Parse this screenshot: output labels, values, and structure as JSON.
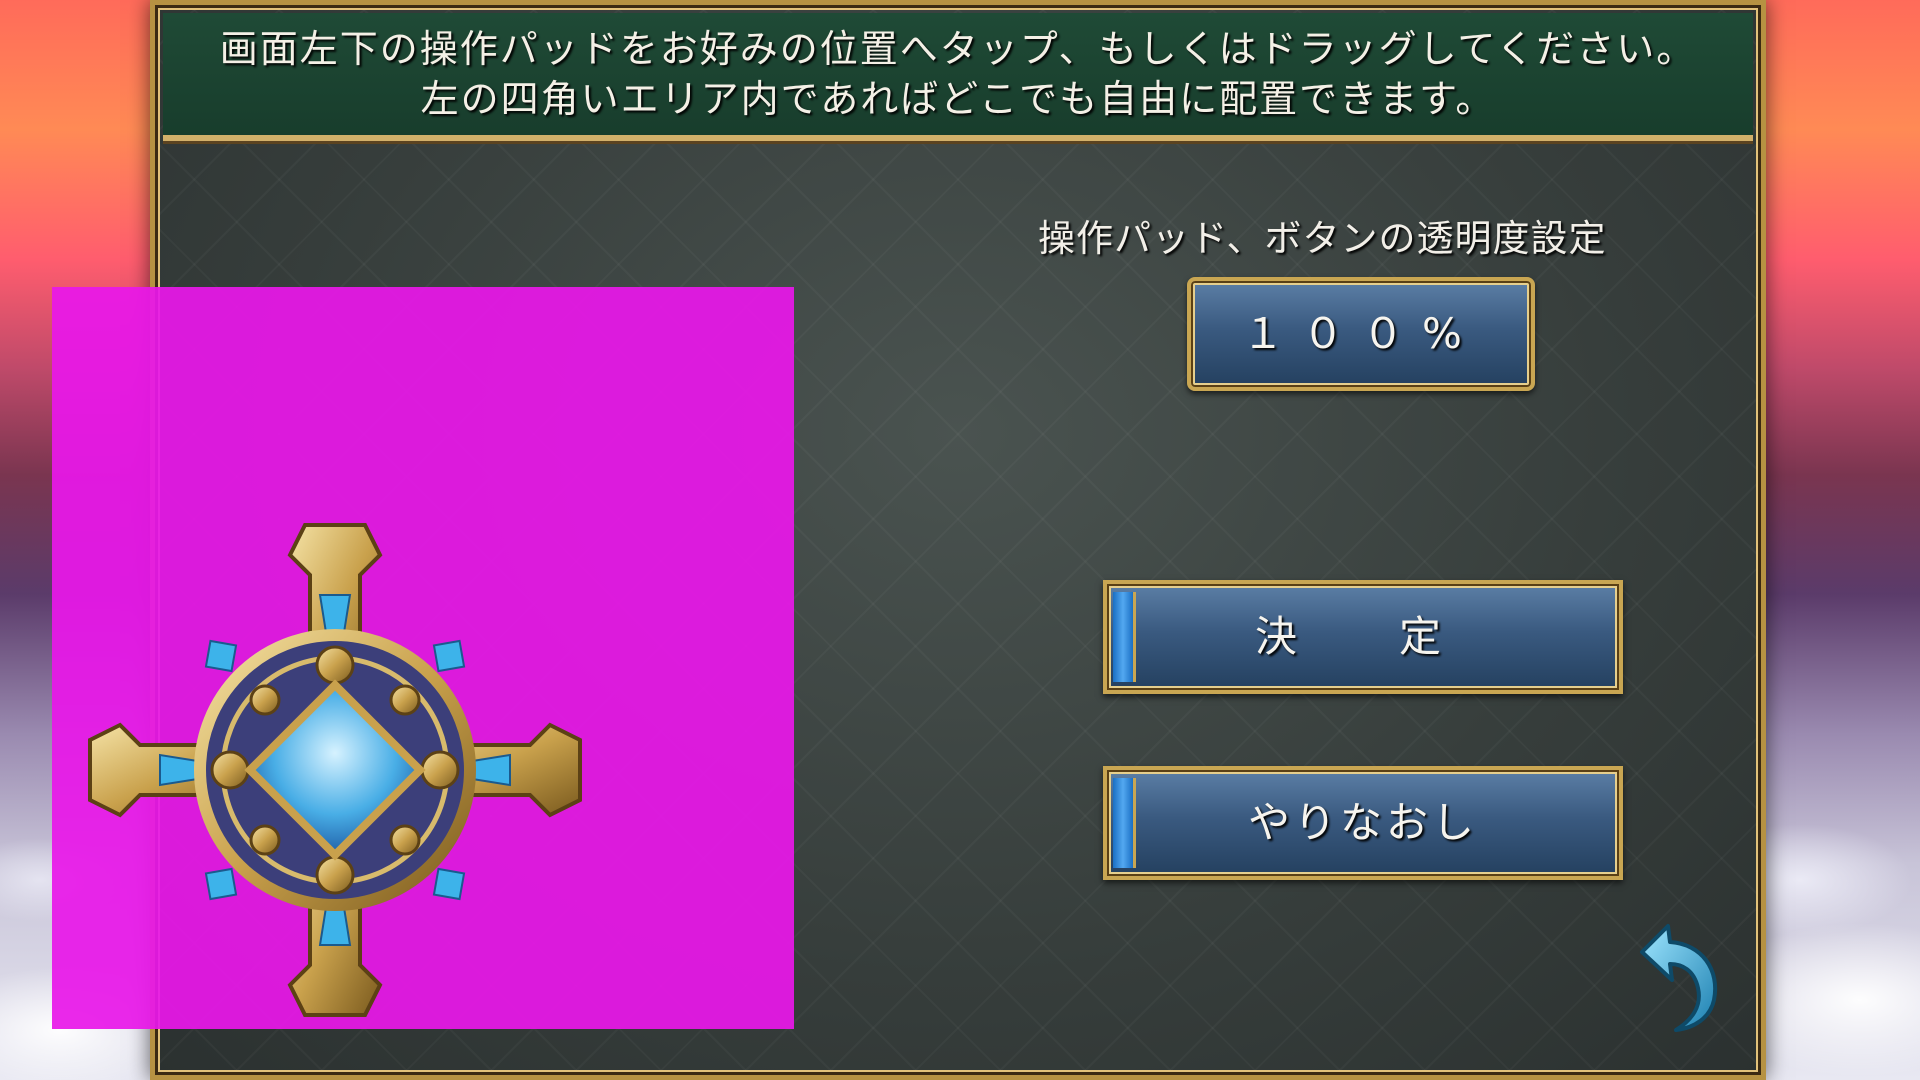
{
  "header": {
    "line1": "画面左下の操作パッドをお好みの位置へタップ、もしくはドラッグしてください。",
    "line2": "左の四角いエリア内であればどこでも自由に配置できます。"
  },
  "opacity": {
    "label": "操作パッド、ボタンの透明度設定",
    "value": "１００%"
  },
  "buttons": {
    "confirm": "決　定",
    "redo": "やりなおし"
  },
  "colors": {
    "pad_area": "#e818e8",
    "header_bg": "#1f4a36",
    "gold": "#c9a652",
    "button_blue": "#3a5a80"
  },
  "icons": {
    "dpad": "ornate-cross-dpad-icon",
    "back": "curved-back-arrow-icon"
  }
}
